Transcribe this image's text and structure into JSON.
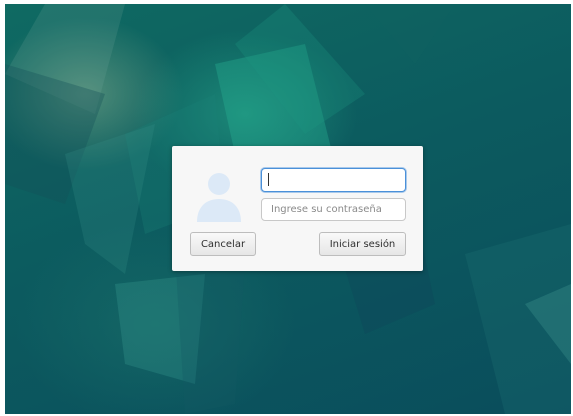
{
  "colors": {
    "background_dark": "#0a4d5c",
    "background_teal": "#0f6a62",
    "dialog_bg": "#f7f7f7",
    "focus_border": "#4a90d9",
    "avatar_fill": "#dce9f7"
  },
  "login": {
    "avatar_icon": "user-avatar-icon",
    "username_value": "",
    "password_placeholder": "Ingrese su contraseña",
    "cancel_label": "Cancelar",
    "signin_label": "Iniciar sesión"
  }
}
